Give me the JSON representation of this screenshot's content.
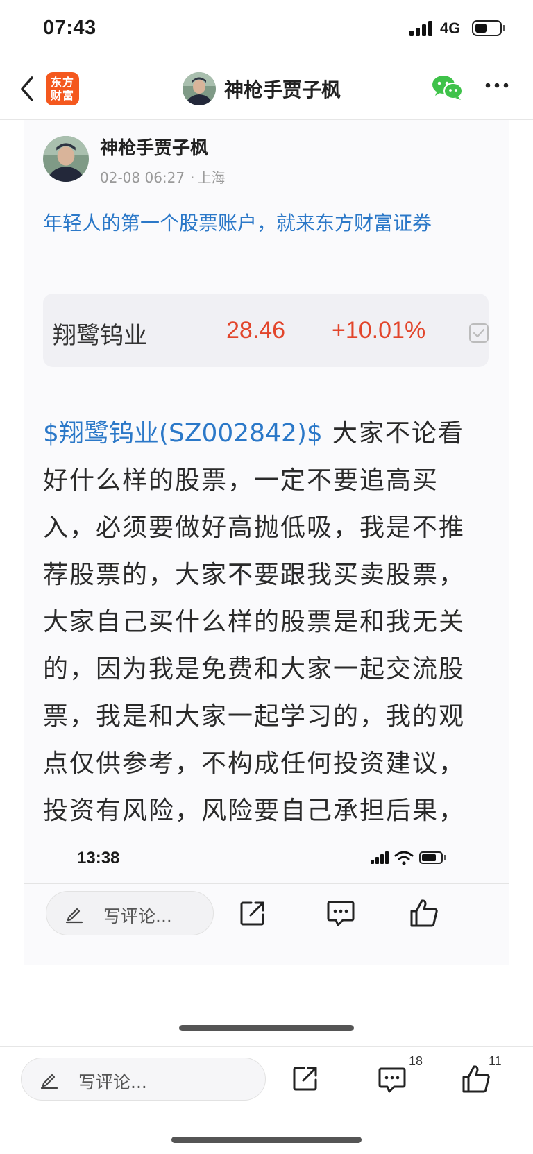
{
  "status_bar": {
    "time": "07:43",
    "network": "4G",
    "battery_level": 0.5
  },
  "nav": {
    "title": "神枪手贾子枫",
    "app_logo_text": "东方财富",
    "icons": [
      "back-icon",
      "app-logo",
      "avatar",
      "wechat-icon",
      "more-icon"
    ]
  },
  "post": {
    "author": "神枪手贾子枫",
    "date": "02-08 06:27",
    "location": "上海",
    "location_separator": "·",
    "promo": "年轻人的第一个股票账户，就来东方财富证券",
    "stock": {
      "name": "翔鹭钨业",
      "price": "28.46",
      "change": "+10.01%",
      "color": "#e2452b"
    },
    "ticker": "$翔鹭钨业(SZ002842)$",
    "body": "大家不论看好什么样的股票，一定不要追高买入，必须要做好高抛低吸，我是不推荐股票的，大家不要跟我买卖股票，大家自己买什么样的股票是和我无关的，因为我是免费和大家一起交流股票，我是和大家一起学习的，我的观点仅供参考，不构成任何投资建议，投资有风险，风险要自己承担后果，"
  },
  "inner_screenshot": {
    "time": "13:38",
    "comment_placeholder": "写评论..."
  },
  "bottom_bar": {
    "comment_placeholder": "写评论...",
    "comment_count": "18",
    "like_count": "11"
  },
  "colors": {
    "link_blue": "#2b78c8",
    "stock_red": "#e2452b",
    "logo_orange": "#f4581e",
    "wechat_green": "#3fc24a"
  }
}
